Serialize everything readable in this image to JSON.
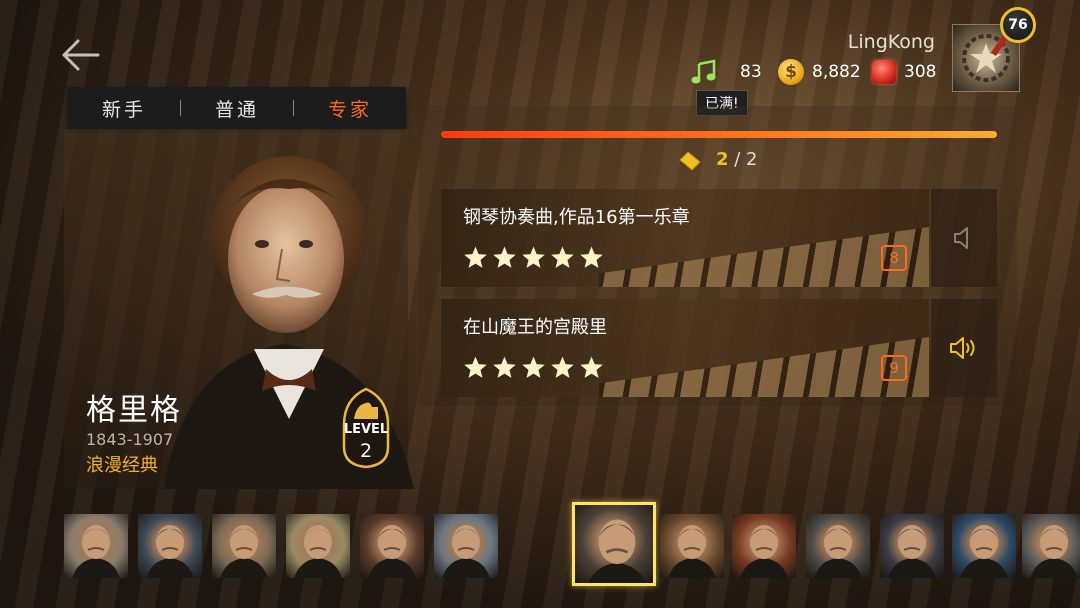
{
  "header": {
    "user_name": "LingKong",
    "player_level": "76",
    "notes": "83",
    "coins": "8,882",
    "gems": "308",
    "coin_symbol": "$",
    "notes_full_label": "已满!"
  },
  "difficulty_tabs": [
    "新手",
    "普通",
    "专家"
  ],
  "active_difficulty_index": 2,
  "composer": {
    "name": "格里格",
    "years": "1843-1907",
    "style": "浪漫经典",
    "level_label": "LEVEL",
    "level": "2"
  },
  "ticket": {
    "current": "2",
    "separator": " / ",
    "total": "2"
  },
  "songs": [
    {
      "title": "钢琴协奏曲,作品16第一乐章",
      "stars": 5,
      "score": "8",
      "speaker_active": false
    },
    {
      "title": "在山魔王的宫殿里",
      "stars": 5,
      "score": "9",
      "speaker_active": true
    }
  ],
  "colors": {
    "accent_orange": "#ff6a1a",
    "gold": "#f0c020",
    "selected_frame": "#ffe560"
  },
  "carousel": {
    "selected_index": 6,
    "thumbnail_count": 13
  }
}
